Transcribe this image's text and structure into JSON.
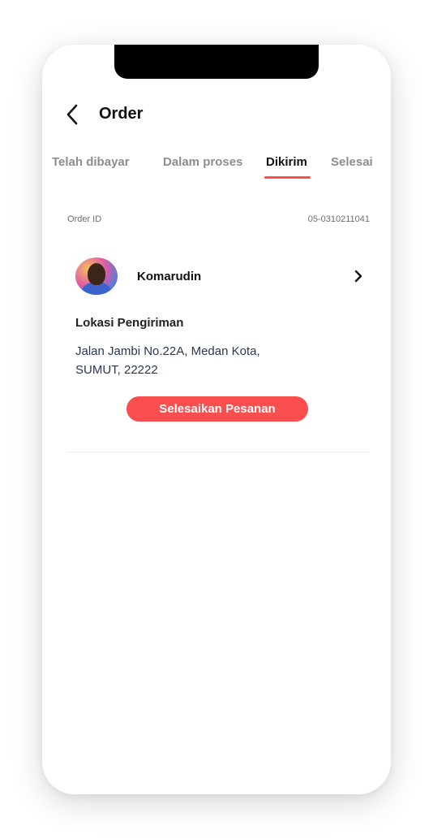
{
  "header": {
    "title": "Order",
    "back_icon": "chevron-left-icon"
  },
  "tabs": [
    {
      "label": "Telah dibayar",
      "active": false
    },
    {
      "label": "Dalam proses",
      "active": false
    },
    {
      "label": "Dikirim",
      "active": true
    },
    {
      "label": "Selesai",
      "active": false
    }
  ],
  "order": {
    "id_label": "Order ID",
    "id_value": "05-0310211041",
    "customer_name": "Komarudin",
    "customer_icon": "chevron-right-icon",
    "shipping_title": "Lokasi Pengiriman",
    "address_line1": "Jalan Jambi No.22A, Medan Kota,",
    "address_line2": "SUMUT, 22222",
    "finish_button": "Selesaikan Pesanan"
  },
  "colors": {
    "accent": "#fb4e4e",
    "text_primary": "#111111",
    "text_muted": "#8d8d8d",
    "address_text": "#2c3553"
  }
}
